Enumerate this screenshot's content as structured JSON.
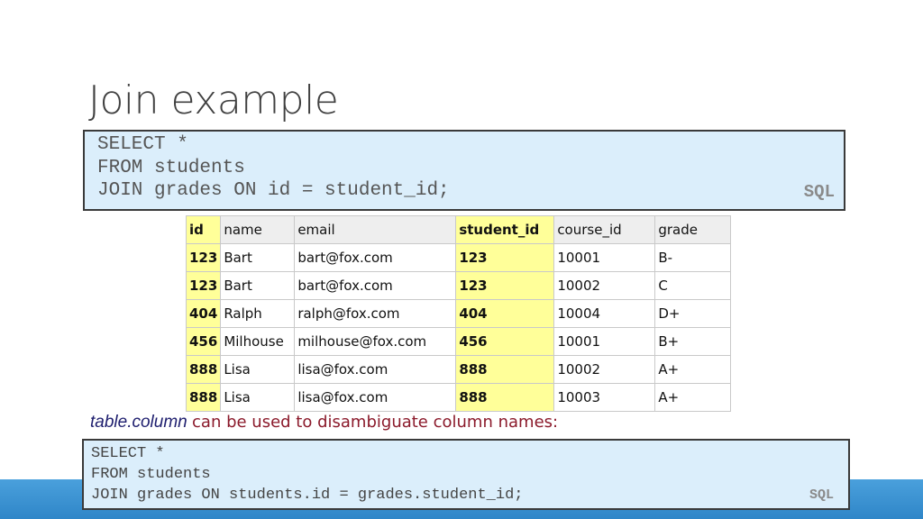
{
  "slide": {
    "title": "Join example"
  },
  "query1": {
    "lines": [
      "SELECT *",
      "FROM students",
      "JOIN grades ON id = student_id;"
    ],
    "language": "SQL"
  },
  "table": {
    "headers": [
      "id",
      "name",
      "email",
      "student_id",
      "course_id",
      "grade"
    ],
    "rows": [
      [
        "123",
        "Bart",
        "bart@fox.com",
        "123",
        "10001",
        "B-"
      ],
      [
        "123",
        "Bart",
        "bart@fox.com",
        "123",
        "10002",
        "C"
      ],
      [
        "404",
        "Ralph",
        "ralph@fox.com",
        "404",
        "10004",
        "D+"
      ],
      [
        "456",
        "Milhouse",
        "milhouse@fox.com",
        "456",
        "10001",
        "B+"
      ],
      [
        "888",
        "Lisa",
        "lisa@fox.com",
        "888",
        "10002",
        "A+"
      ],
      [
        "888",
        "Lisa",
        "lisa@fox.com",
        "888",
        "10003",
        "A+"
      ]
    ],
    "highlight_color": "#ffff99"
  },
  "note": {
    "code": "table.column",
    "text": "can be used to disambiguate column names:"
  },
  "query2": {
    "lines": [
      "SELECT *",
      "FROM students",
      "JOIN grades ON students.id = grades.student_id;"
    ],
    "language": "SQL"
  },
  "colors": {
    "code_background": "#dbeefb",
    "accent_bar": "#2f86c8"
  }
}
